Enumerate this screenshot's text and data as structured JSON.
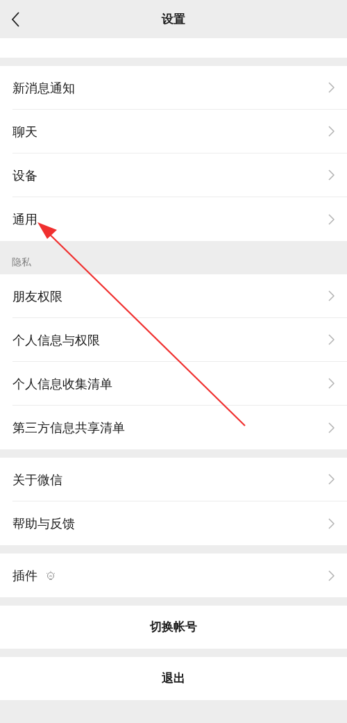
{
  "header": {
    "title": "设置"
  },
  "sections": [
    {
      "kind": "cut_row"
    },
    {
      "kind": "group",
      "items": [
        {
          "kind": "link",
          "label": "新消息通知"
        },
        {
          "kind": "link",
          "label": "聊天"
        },
        {
          "kind": "link",
          "label": "设备"
        },
        {
          "kind": "link",
          "label": "通用"
        }
      ]
    },
    {
      "kind": "label",
      "text": "隐私"
    },
    {
      "kind": "group",
      "items": [
        {
          "kind": "link",
          "label": "朋友权限"
        },
        {
          "kind": "link",
          "label": "个人信息与权限"
        },
        {
          "kind": "link",
          "label": "个人信息收集清单"
        },
        {
          "kind": "link",
          "label": "第三方信息共享清单"
        }
      ]
    },
    {
      "kind": "group",
      "items": [
        {
          "kind": "link",
          "label": "关于微信"
        },
        {
          "kind": "link",
          "label": "帮助与反馈"
        }
      ]
    },
    {
      "kind": "group",
      "items": [
        {
          "kind": "link_bulb",
          "label": "插件"
        }
      ]
    },
    {
      "kind": "group",
      "items": [
        {
          "kind": "action",
          "label": "切换帐号"
        }
      ]
    },
    {
      "kind": "group",
      "items": [
        {
          "kind": "action",
          "label": "退出"
        }
      ]
    }
  ]
}
